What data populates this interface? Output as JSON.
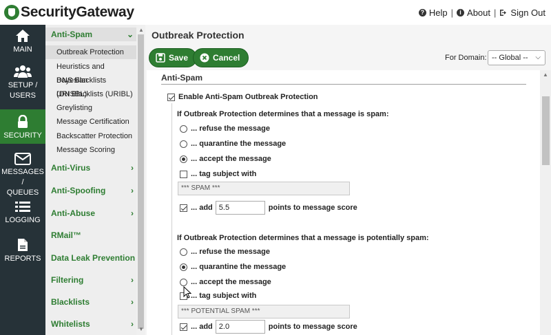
{
  "header": {
    "logo_text": "SecurityGateway",
    "links": [
      {
        "label": "Help",
        "icon": "help-icon"
      },
      {
        "label": "About",
        "icon": "info-icon"
      },
      {
        "label": "Sign Out",
        "icon": "sign-out-icon"
      }
    ],
    "separator": "|"
  },
  "leftnav": {
    "items": [
      {
        "label": "MAIN",
        "icon": "home-icon"
      },
      {
        "label": "SETUP /",
        "label2": "USERS",
        "icon": "users-icon"
      },
      {
        "label": "SECURITY",
        "icon": "lock-icon",
        "active": true
      },
      {
        "label": "MESSAGES /",
        "label2": "QUEUES",
        "icon": "envelope-icon"
      },
      {
        "label": "LOGGING",
        "icon": "list-icon"
      },
      {
        "label": "REPORTS",
        "icon": "report-icon"
      }
    ]
  },
  "subnav": {
    "sections": [
      {
        "label": "Anti-Spam",
        "chevron": "⌄"
      },
      {
        "label": "Anti-Virus",
        "chevron": "›"
      },
      {
        "label": "Anti-Spoofing",
        "chevron": "›"
      },
      {
        "label": "Anti-Abuse",
        "chevron": "›"
      },
      {
        "label": "RMail™",
        "chevron": ""
      },
      {
        "label": "Data Leak Prevention",
        "chevron": ""
      },
      {
        "label": "Filtering",
        "chevron": "›"
      },
      {
        "label": "Blacklists",
        "chevron": "›"
      },
      {
        "label": "Whitelists",
        "chevron": "›"
      }
    ],
    "antispam_items": [
      "Outbreak Protection",
      "Heuristics and Bayesian",
      "DNS Blacklists (DNSBL)",
      "URI Blacklists (URIBL)",
      "Greylisting",
      "Message Certification",
      "Backscatter Protection",
      "Message Scoring"
    ],
    "selected": "Outbreak Protection"
  },
  "main": {
    "title": "Outbreak Protection",
    "save_label": "Save",
    "cancel_label": "Cancel",
    "domain_label": "For Domain:",
    "domain_value": "-- Global --",
    "group_title": "Anti-Spam",
    "enable_label": "Enable Anti-Spam Outbreak Protection",
    "enable_checked": true,
    "spam": {
      "heading": "If Outbreak Protection determines that a message is spam:",
      "options": [
        "... refuse the message",
        "... quarantine the message",
        "... accept the message"
      ],
      "selected_index": 2,
      "tag_label": "... tag subject with",
      "tag_checked": false,
      "tag_value": "*** SPAM ***",
      "add_label": "... add",
      "add_checked": true,
      "add_value": "5.5",
      "points_label": "points to message score"
    },
    "potential": {
      "heading": "If Outbreak Protection determines that a message is potentially spam:",
      "options": [
        "... refuse the message",
        "... quarantine the message",
        "... accept the message"
      ],
      "selected_index": 1,
      "tag_label": "... tag subject with",
      "tag_checked": false,
      "tag_value": "*** POTENTIAL SPAM ***",
      "add_label": "... add",
      "add_checked": true,
      "add_value": "2.0",
      "points_label": "points to message score"
    }
  },
  "colors": {
    "accent_green": "#2e7d32",
    "nav_dark": "#263238"
  }
}
